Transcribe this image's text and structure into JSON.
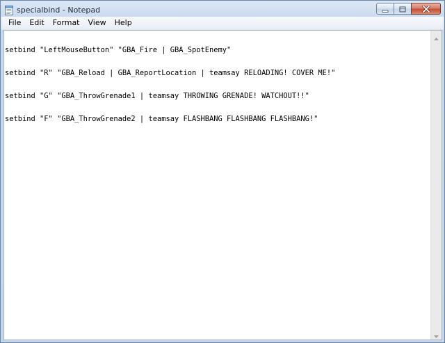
{
  "window": {
    "title": "specialbind - Notepad"
  },
  "menu": {
    "items": [
      {
        "label": "File"
      },
      {
        "label": "Edit"
      },
      {
        "label": "Format"
      },
      {
        "label": "View"
      },
      {
        "label": "Help"
      }
    ]
  },
  "document": {
    "lines": [
      "setbind \"LeftMouseButton\" \"GBA_Fire | GBA_SpotEnemy\"",
      "setbind \"R\" \"GBA_Reload | GBA_ReportLocation | teamsay RELOADING! COVER ME!\"",
      "setbind \"G\" \"GBA_ThrowGrenade1 | teamsay THROWING GRENADE! WATCHOUT!!\"",
      "setbind \"F\" \"GBA_ThrowGrenade2 | teamsay FLASHBANG FLASHBANG FLASHBANG!\""
    ]
  },
  "icons": {
    "app": "notepad-icon",
    "minimize": "minimize-icon",
    "maximize": "maximize-icon",
    "close": "close-icon",
    "scroll_up": "chevron-up-icon",
    "scroll_down": "chevron-down-icon"
  },
  "colors": {
    "close_button": "#c44f35",
    "window_frame": "#c2d5ea",
    "editor_background": "#ffffff"
  }
}
